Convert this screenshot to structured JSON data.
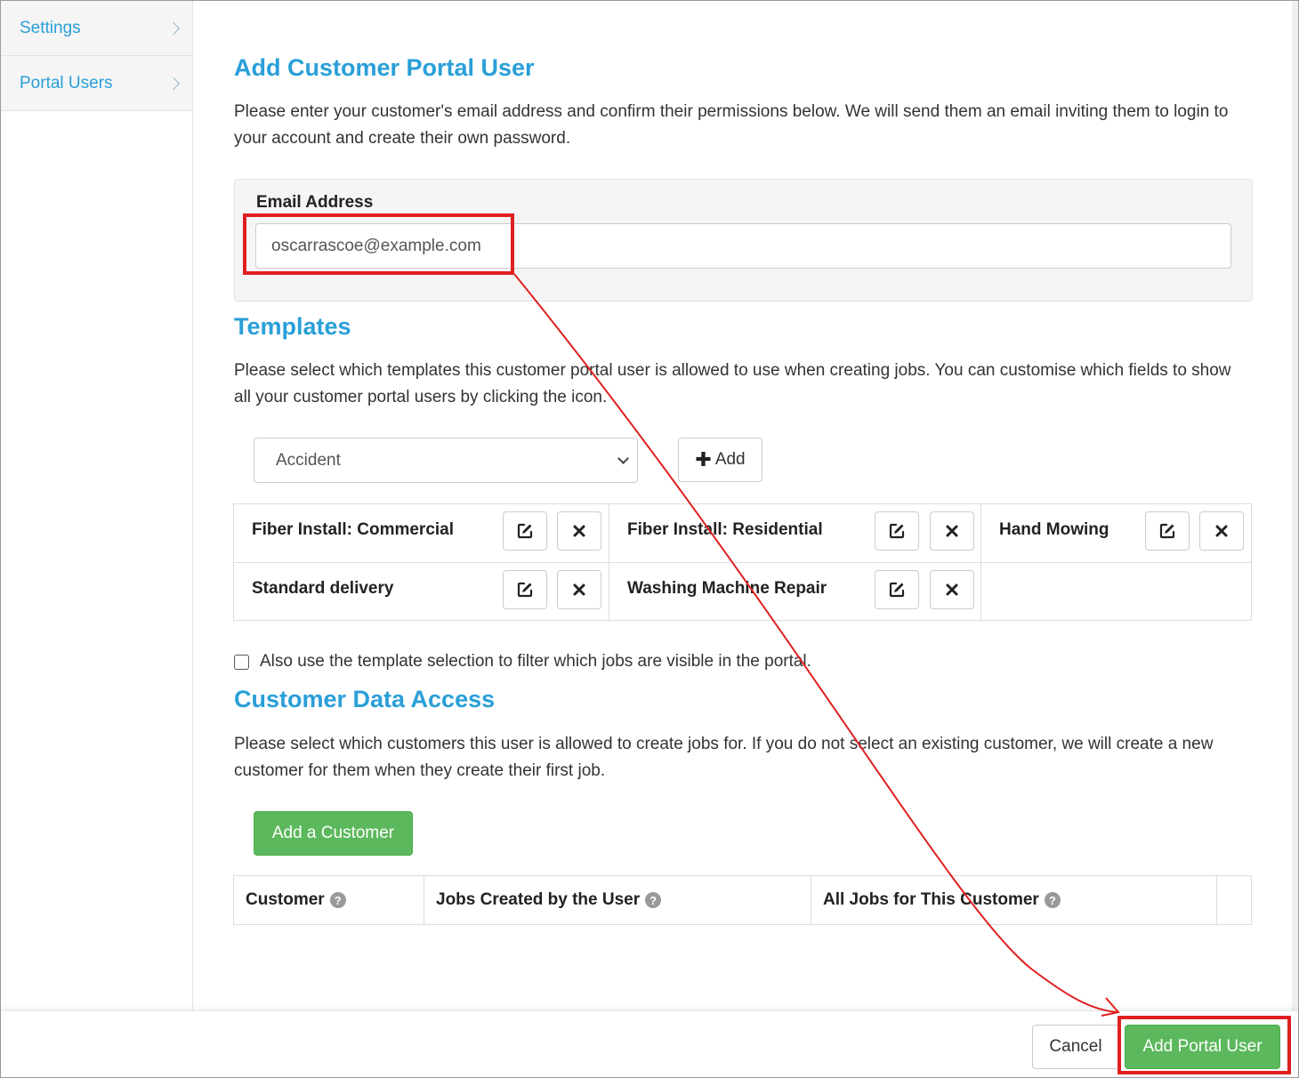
{
  "sidebar": {
    "items": [
      {
        "label": "Settings"
      },
      {
        "label": "Portal Users"
      }
    ]
  },
  "page": {
    "title": "Add Customer Portal User",
    "intro": "Please enter your customer's email address and confirm their permissions below. We will send them an email inviting them to login to your account and create their own password."
  },
  "email": {
    "label": "Email Address",
    "value": "oscarrascoe@example.com"
  },
  "templates": {
    "heading": "Templates",
    "description": "Please select which templates this customer portal user is allowed to use when creating jobs. You can customise which fields to show all your customer portal users by clicking the icon.",
    "selected": "Accident",
    "add_label": "Add",
    "items": [
      {
        "name": "Fiber Install: Commercial"
      },
      {
        "name": "Fiber Install: Residential"
      },
      {
        "name": "Hand Mowing"
      },
      {
        "name": "Standard delivery"
      },
      {
        "name": "Washing Machine Repair"
      }
    ],
    "filter_label": "Also use the template selection to filter which jobs are visible in the portal."
  },
  "customers": {
    "heading": "Customer Data Access",
    "description": "Please select which customers this user is allowed to create jobs for. If you do not select an existing customer, we will create a new customer for them when they create their first job.",
    "add_button": "Add a Customer",
    "columns": [
      "Customer",
      "Jobs Created by the User",
      "All Jobs for This Customer"
    ],
    "help_glyph": "?"
  },
  "footer": {
    "cancel": "Cancel",
    "submit": "Add Portal User"
  },
  "colors": {
    "accent": "#2a9fd8",
    "success": "#5cb85c",
    "annotation": "#e02020"
  },
  "icons": {
    "edit": "edit-icon",
    "remove": "close-icon",
    "plus": "plus-icon",
    "chevron": "chevron-right-icon",
    "help": "help-circle-icon"
  }
}
